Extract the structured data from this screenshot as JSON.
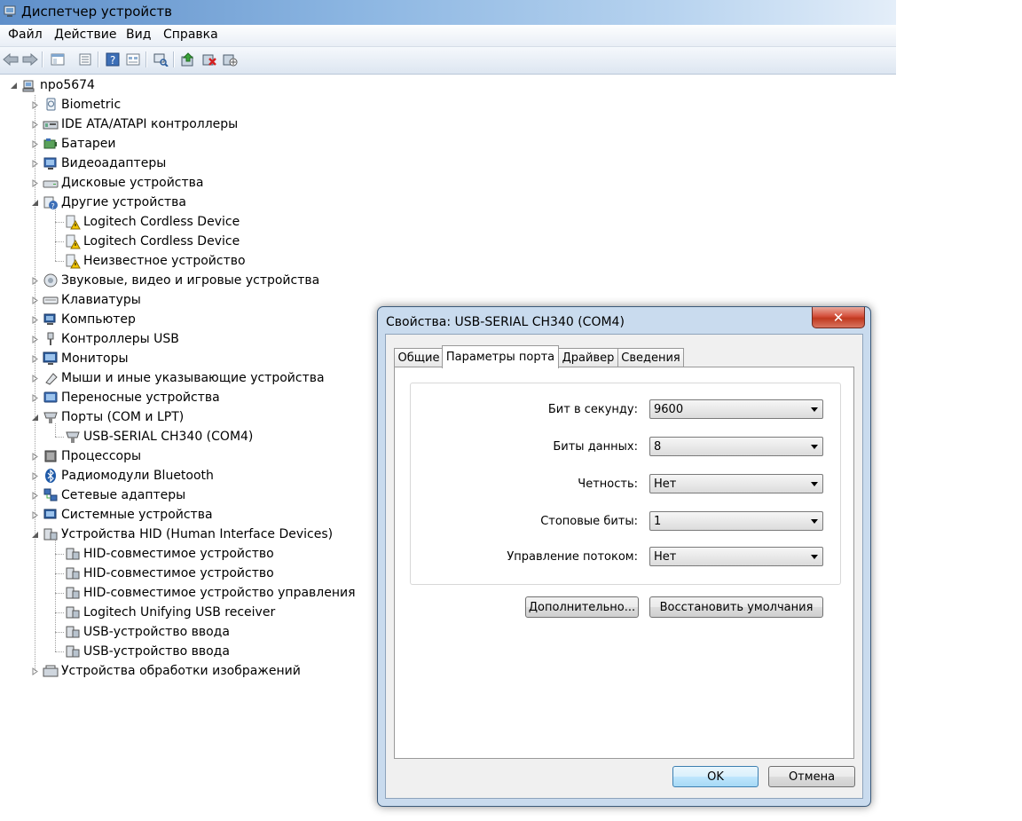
{
  "window": {
    "title": "Диспетчер устройств"
  },
  "menu": [
    "Файл",
    "Действие",
    "Вид",
    "Справка"
  ],
  "toolbar": {
    "buttons": [
      "back-icon",
      "forward-icon",
      "show-hide-tree-icon",
      "properties-icon",
      "help-icon",
      "view-icon",
      "scan-hardware-icon",
      "update-driver-icon",
      "uninstall-icon",
      "disable-icon"
    ]
  },
  "tree": {
    "root": "npo5674",
    "categories": [
      {
        "label": "Biometric",
        "icon": "biometric-icon"
      },
      {
        "label": "IDE ATA/ATAPI контроллеры",
        "icon": "ide-controller-icon"
      },
      {
        "label": "Батареи",
        "icon": "battery-icon"
      },
      {
        "label": "Видеоадаптеры",
        "icon": "display-adapter-icon"
      },
      {
        "label": "Дисковые устройства",
        "icon": "disk-drive-icon"
      },
      {
        "label": "Другие устройства",
        "icon": "other-devices-icon",
        "expanded": true,
        "children": [
          "Logitech Cordless Device",
          "Logitech Cordless Device",
          "Неизвестное устройство"
        ]
      },
      {
        "label": "Звуковые, видео и игровые устройства",
        "icon": "sound-icon"
      },
      {
        "label": "Клавиатуры",
        "icon": "keyboard-icon"
      },
      {
        "label": "Компьютер",
        "icon": "computer-icon"
      },
      {
        "label": "Контроллеры USB",
        "icon": "usb-controller-icon"
      },
      {
        "label": "Мониторы",
        "icon": "monitor-icon"
      },
      {
        "label": "Мыши и иные указывающие устройства",
        "icon": "mouse-icon"
      },
      {
        "label": "Переносные устройства",
        "icon": "portable-device-icon"
      },
      {
        "label": "Порты (COM и LPT)",
        "icon": "port-icon",
        "expanded": true,
        "children": [
          "USB-SERIAL CH340 (COM4)"
        ]
      },
      {
        "label": "Процессоры",
        "icon": "processor-icon"
      },
      {
        "label": "Радиомодули Bluetooth",
        "icon": "bluetooth-icon"
      },
      {
        "label": "Сетевые адаптеры",
        "icon": "network-adapter-icon"
      },
      {
        "label": "Системные устройства",
        "icon": "system-device-icon"
      },
      {
        "label": "Устройства HID (Human Interface Devices)",
        "icon": "hid-icon",
        "expanded": true,
        "children": [
          "HID-совместимое устройство",
          "HID-совместимое устройство",
          "HID-совместимое устройство управления",
          "Logitech Unifying USB receiver",
          "USB-устройство ввода",
          "USB-устройство ввода"
        ]
      },
      {
        "label": "Устройства обработки изображений",
        "icon": "imaging-device-icon"
      }
    ]
  },
  "dialog": {
    "title": "Свойства: USB-SERIAL CH340 (COM4)",
    "close_label": "✕",
    "tabs": [
      "Общие",
      "Параметры порта",
      "Драйвер",
      "Сведения"
    ],
    "active_tab": "Параметры порта",
    "fields": [
      {
        "label": "Бит в секунду:",
        "value": "9600"
      },
      {
        "label": "Биты данных:",
        "value": "8"
      },
      {
        "label": "Четность:",
        "value": "Нет"
      },
      {
        "label": "Стоповые биты:",
        "value": "1"
      },
      {
        "label": "Управление потоком:",
        "value": "Нет"
      }
    ],
    "advanced_button": "Дополнительно...",
    "restore_button": "Восстановить умолчания",
    "ok_button": "OK",
    "cancel_button": "Отмена"
  }
}
